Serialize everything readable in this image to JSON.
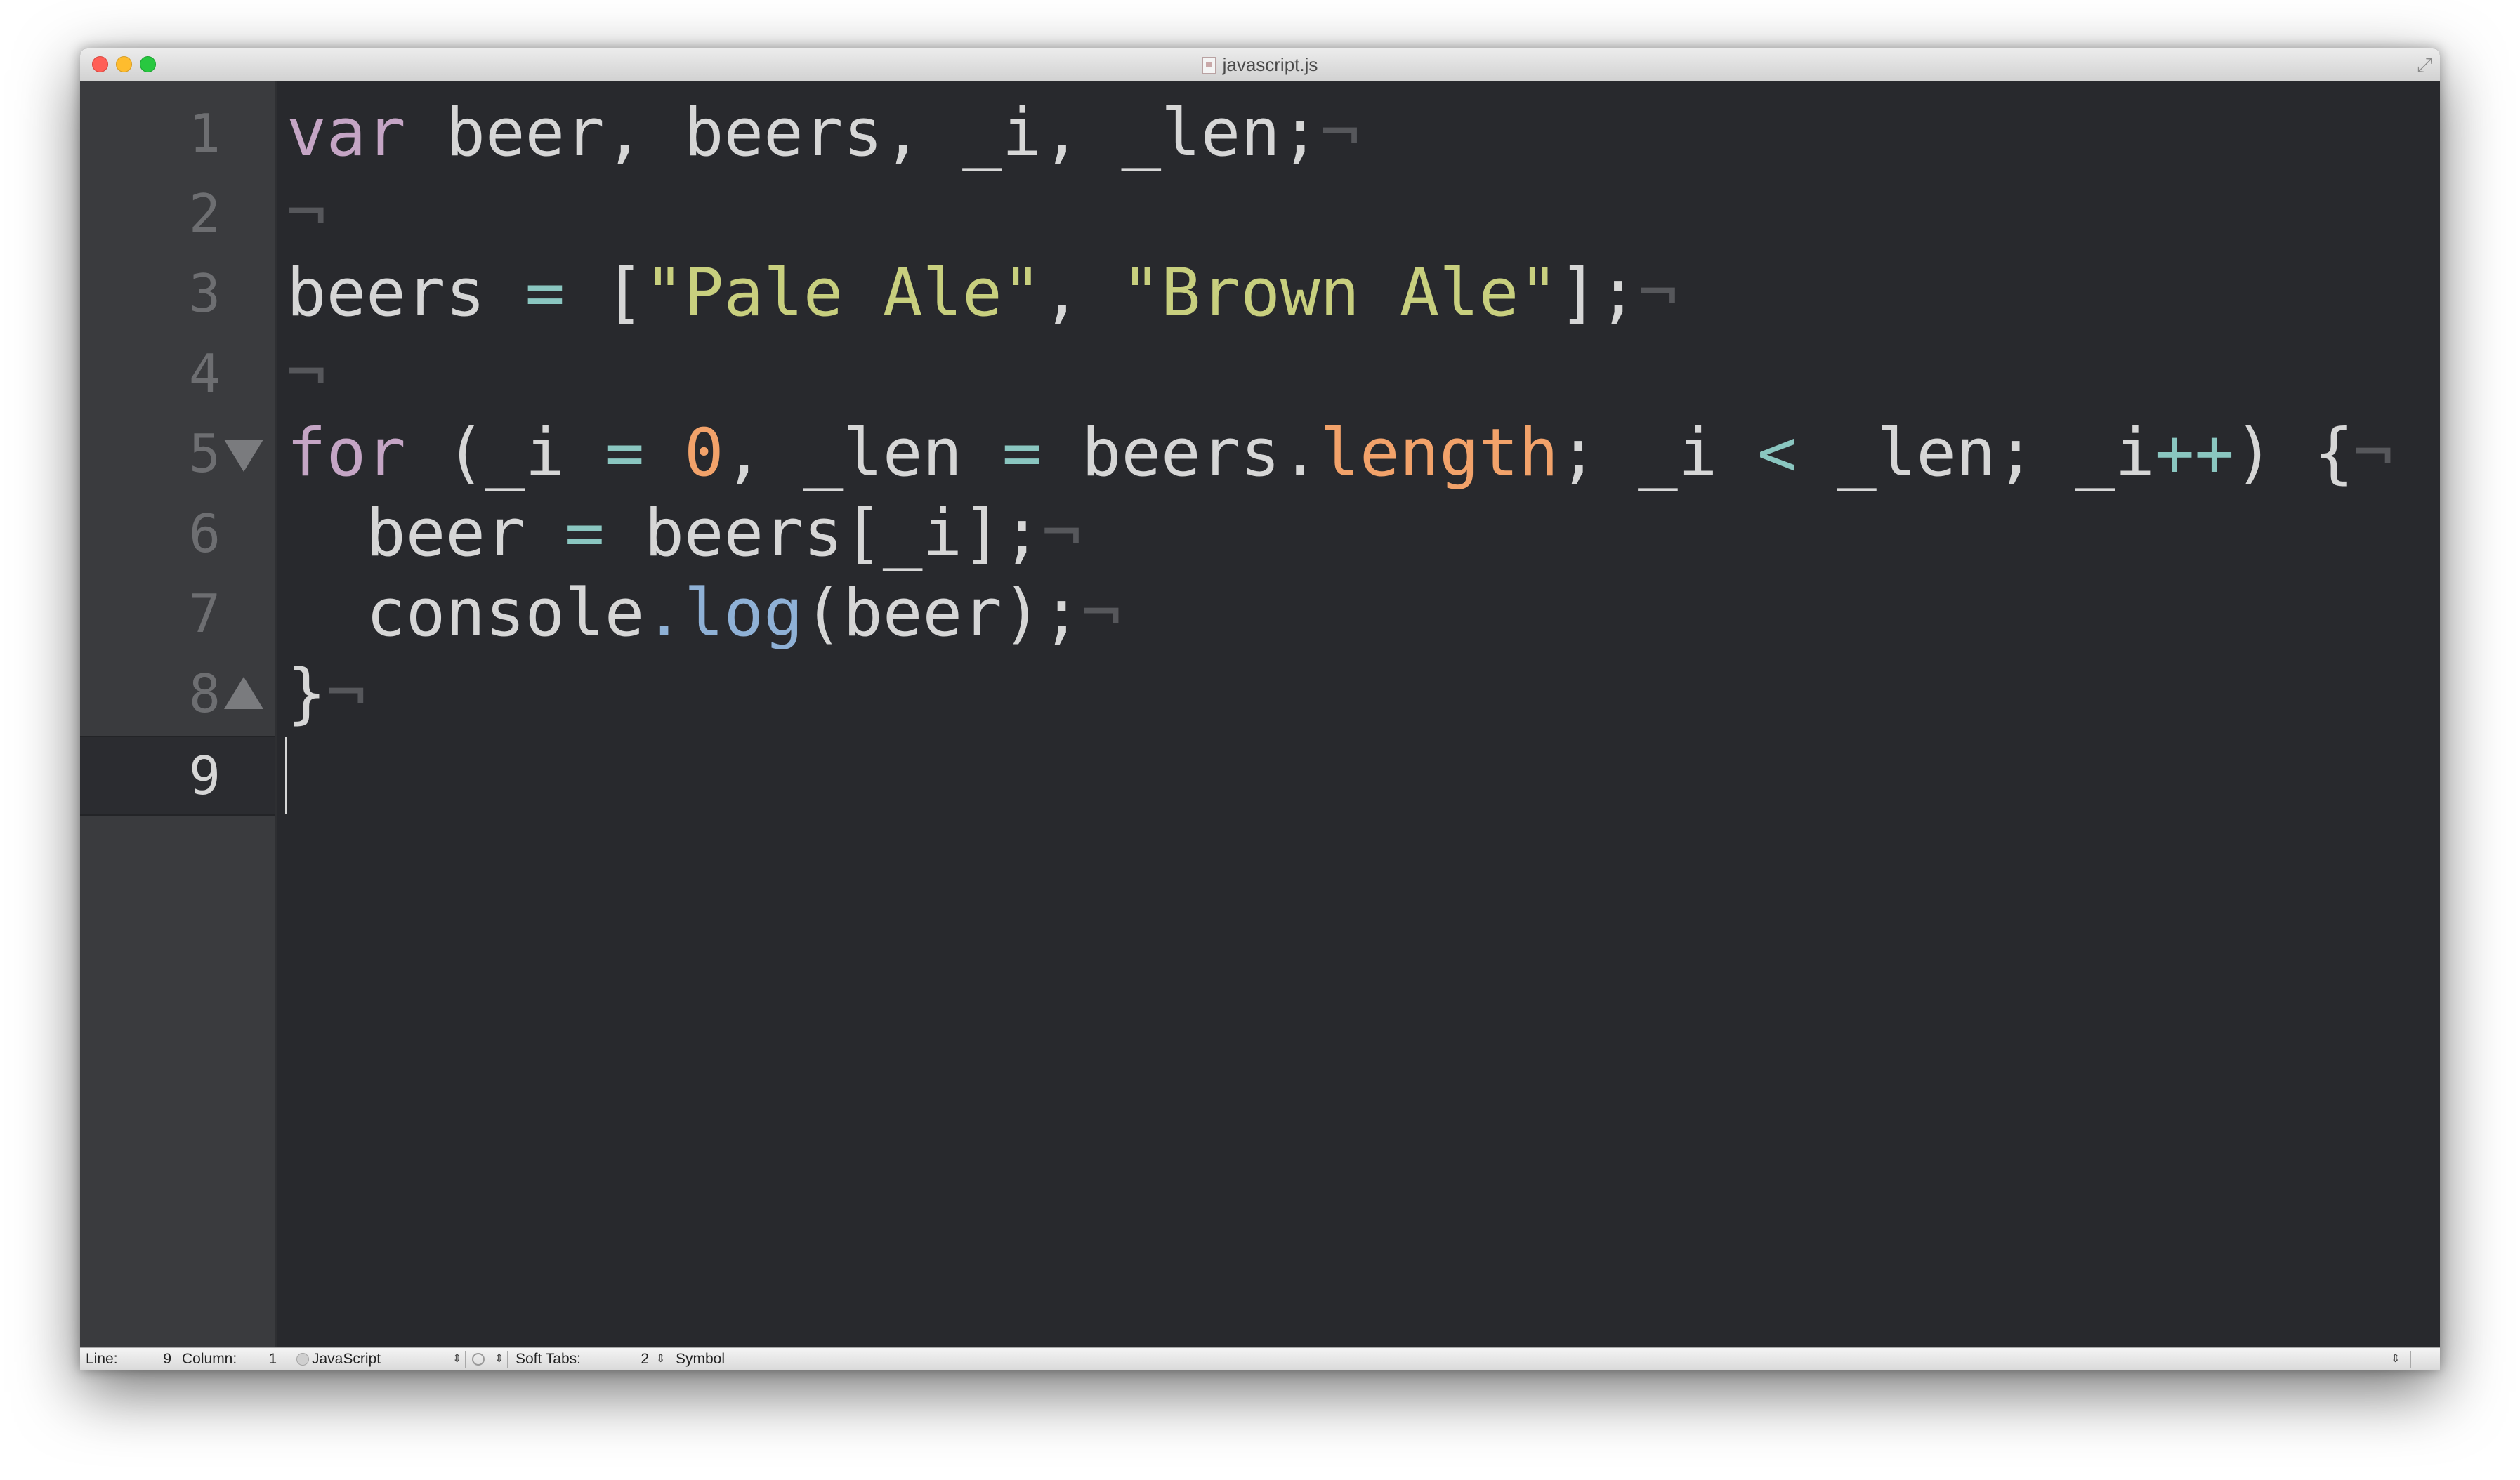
{
  "window": {
    "title": "javascript.js"
  },
  "gutter": {
    "line_numbers": [
      "1",
      "2",
      "3",
      "4",
      "5",
      "6",
      "7",
      "8",
      "9"
    ],
    "current_line": "9"
  },
  "code": {
    "lines": [
      [
        {
          "t": "var",
          "c": "kw"
        },
        {
          "t": " beer, beers, _i, _len;",
          "c": ""
        },
        {
          "t": "¬",
          "c": "nl"
        }
      ],
      [
        {
          "t": "¬",
          "c": "nl"
        }
      ],
      [
        {
          "t": "beers ",
          "c": ""
        },
        {
          "t": "=",
          "c": "op"
        },
        {
          "t": " [",
          "c": ""
        },
        {
          "t": "\"Pale Ale\"",
          "c": "str"
        },
        {
          "t": ", ",
          "c": ""
        },
        {
          "t": "\"Brown Ale\"",
          "c": "str"
        },
        {
          "t": "];",
          "c": ""
        },
        {
          "t": "¬",
          "c": "nl"
        }
      ],
      [
        {
          "t": "¬",
          "c": "nl"
        }
      ],
      [
        {
          "t": "for",
          "c": "kw"
        },
        {
          "t": " (_i ",
          "c": ""
        },
        {
          "t": "=",
          "c": "op"
        },
        {
          "t": " ",
          "c": ""
        },
        {
          "t": "0",
          "c": "num"
        },
        {
          "t": ", _len ",
          "c": ""
        },
        {
          "t": "=",
          "c": "op"
        },
        {
          "t": " beers.",
          "c": ""
        },
        {
          "t": "length",
          "c": "prop"
        },
        {
          "t": "; _i ",
          "c": ""
        },
        {
          "t": "<",
          "c": "op"
        },
        {
          "t": " _len; _i",
          "c": ""
        },
        {
          "t": "++",
          "c": "op"
        },
        {
          "t": ") {",
          "c": ""
        },
        {
          "t": "¬",
          "c": "nl"
        }
      ],
      [
        {
          "t": "  beer ",
          "c": ""
        },
        {
          "t": "=",
          "c": "op"
        },
        {
          "t": " beers[_i];",
          "c": ""
        },
        {
          "t": "¬",
          "c": "nl"
        }
      ],
      [
        {
          "t": "  console",
          "c": ""
        },
        {
          "t": ".",
          "c": "fn"
        },
        {
          "t": "log",
          "c": "fn"
        },
        {
          "t": "(beer);",
          "c": ""
        },
        {
          "t": "¬",
          "c": "nl"
        }
      ],
      [
        {
          "t": "}",
          "c": ""
        },
        {
          "t": "¬",
          "c": "nl"
        }
      ],
      []
    ]
  },
  "statusbar": {
    "line_label": "Line:",
    "line_value": "9",
    "column_label": "Column:",
    "column_value": "1",
    "language": "JavaScript",
    "soft_tabs_label": "Soft Tabs:",
    "soft_tabs_value": "2",
    "symbol_label": "Symbol"
  },
  "icons": {
    "close": "close-dot-icon",
    "minimize": "minimize-dot-icon",
    "zoom": "zoom-dot-icon",
    "file": "file-icon",
    "fullscreen": "fullscreen-arrows-icon",
    "fold_open": "fold-triangle-down-icon",
    "fold_close": "fold-triangle-up-icon",
    "language": "language-icon",
    "gear": "gear-icon"
  },
  "colors": {
    "background": "#28292d",
    "gutter": "#3a3b3e",
    "keyword": "#c5a5c5",
    "operator": "#8ac6c0",
    "string": "#c8cf7e",
    "number": "#f2a26a",
    "function": "#8fb1d6",
    "invisible": "#56575b"
  }
}
